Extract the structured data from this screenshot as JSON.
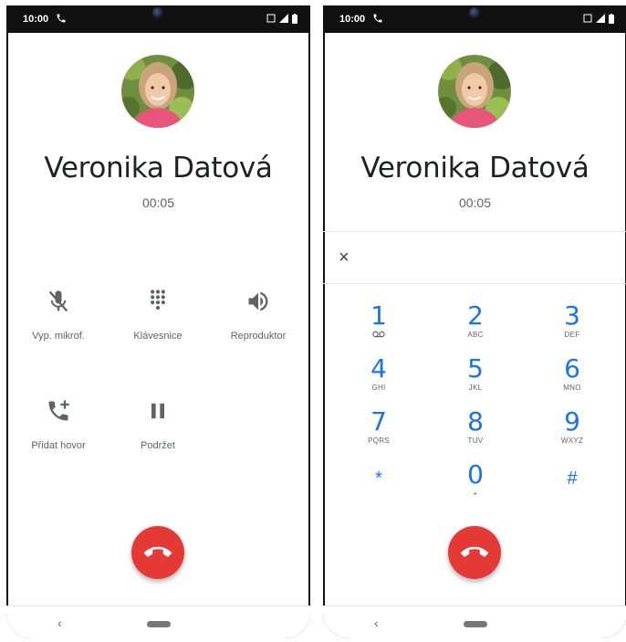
{
  "status_bar": {
    "time": "10:00"
  },
  "left_screen": {
    "caller_name": "Veronika Datová",
    "call_timer": "00:05",
    "controls": [
      {
        "label": "Vyp. mikrof.",
        "icon": "mic-off-icon"
      },
      {
        "label": "Klávesnice",
        "icon": "dialpad-icon"
      },
      {
        "label": "Reproduktor",
        "icon": "speaker-icon"
      },
      {
        "label": "Přidat hovor",
        "icon": "add-call-icon"
      },
      {
        "label": "Podržet",
        "icon": "pause-icon"
      }
    ]
  },
  "right_screen": {
    "caller_name": "Veronika Datová",
    "call_timer": "00:05",
    "close_symbol": "×",
    "keys": [
      {
        "digit": "1",
        "letters": ""
      },
      {
        "digit": "2",
        "letters": "ABC"
      },
      {
        "digit": "3",
        "letters": "DEF"
      },
      {
        "digit": "4",
        "letters": "GHI"
      },
      {
        "digit": "5",
        "letters": "JKL"
      },
      {
        "digit": "6",
        "letters": "MNO"
      },
      {
        "digit": "7",
        "letters": "PQRS"
      },
      {
        "digit": "8",
        "letters": "TUV"
      },
      {
        "digit": "9",
        "letters": "WXYZ"
      },
      {
        "digit": "*",
        "letters": ""
      },
      {
        "digit": "0",
        "letters": "+"
      },
      {
        "digit": "#",
        "letters": ""
      }
    ]
  },
  "nav": {
    "back_symbol": "‹"
  },
  "colors": {
    "accent": "#1a73e8",
    "end_call": "#e53935",
    "status_bar": "#111111"
  }
}
